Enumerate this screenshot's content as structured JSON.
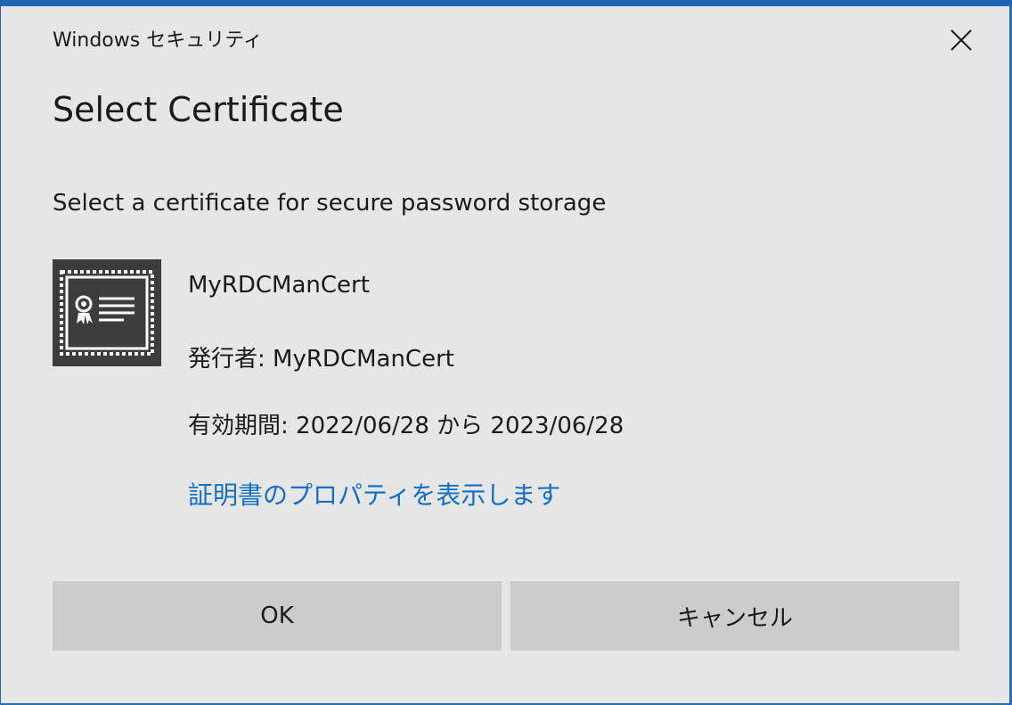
{
  "dialog": {
    "window_title": "Windows セキュリティ",
    "close_icon": "close-icon",
    "heading": "Select Certificate",
    "description": "Select a certificate for secure password storage"
  },
  "certificate": {
    "icon": "certificate-icon",
    "name": "MyRDCManCert",
    "issuer": "発行者: MyRDCManCert",
    "validity": "有効期間: 2022/06/28 から 2023/06/28",
    "properties_link": "証明書のプロパティを表示します"
  },
  "buttons": {
    "ok_label": "OK",
    "cancel_label": "キャンセル"
  },
  "colors": {
    "dialog_background": "#e6e6e6",
    "button_background": "#cccccc",
    "link": "#0f6fc6",
    "icon_background": "#3c3c3c",
    "window_border": "#1f63b5"
  }
}
